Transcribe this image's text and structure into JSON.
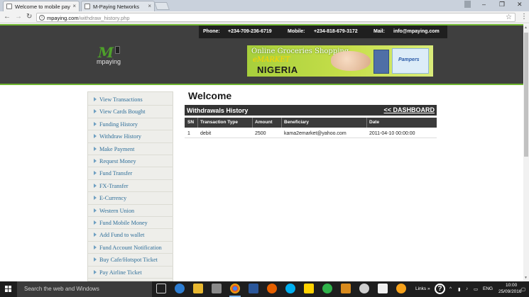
{
  "browser": {
    "tabs": [
      {
        "title": "Welcome to mobile pay",
        "close": "×"
      },
      {
        "title": "M-Paying Networks",
        "close": "×"
      }
    ],
    "nav": {
      "back": "←",
      "forward": "→",
      "reload": "↻"
    },
    "url_host": "mpaying.com",
    "url_path": "/withdraw_history.php",
    "window": {
      "minimize": "–",
      "restore": "❐",
      "close": "✕"
    }
  },
  "contact": {
    "phone_label": "Phone:",
    "phone": "+234-709-236-6719",
    "mobile_label": "Mobile:",
    "mobile": "+234-818-679-3172",
    "mail_label": "Mail:",
    "mail": "info@mpaying.com"
  },
  "logo": {
    "mark": "M",
    "text": "mpaying"
  },
  "banner": {
    "headline": "Online Groceries Shopping",
    "brand": "eMARKET",
    "country": "NIGERIA",
    "product": "Pampers"
  },
  "sidebar": {
    "items": [
      "View Transactions",
      "View Cards Bought",
      "Funding History",
      "Withdraw History",
      "Make Payment",
      "Request Money",
      "Fund Transfer",
      "FX-Transfer",
      "E-Currency",
      "Western Union",
      "Fund Mobile Money",
      "Add Fund to wallet",
      "Fund Account Notification",
      "Buy Cafe/Hotspot Ticket",
      "Pay Airline Ticket"
    ]
  },
  "main": {
    "welcome": "Welcome",
    "section_title": "Withdrawals History",
    "dashboard_link": "<< DASHBOARD",
    "table": {
      "headers": [
        "SN",
        "Transaction Type",
        "Amount",
        "Beneficiary",
        "Date"
      ],
      "rows": [
        [
          "1",
          "debit",
          "2500",
          "kama2emarket@yahoo.com",
          "2011-04-10 00:00:00"
        ]
      ]
    }
  },
  "taskbar": {
    "search_placeholder": "Search the web and Windows",
    "links_label": "Links",
    "lang": "ENG",
    "time": "10:00",
    "date": "25/09/2016"
  },
  "colors": {
    "accent_green": "#6fb530",
    "header_bg": "#3f3f3f",
    "link_blue": "#2f6f9a"
  }
}
